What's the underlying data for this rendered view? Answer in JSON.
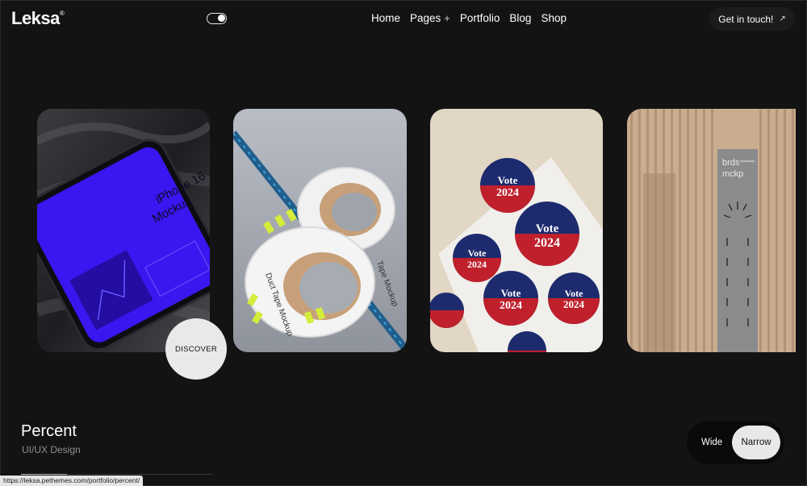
{
  "brand": {
    "logo": "Leksa",
    "logo_mark": "®"
  },
  "nav": {
    "items": [
      {
        "label": "Home"
      },
      {
        "label": "Pages",
        "suffix": "+"
      },
      {
        "label": "Portfolio"
      },
      {
        "label": "Blog"
      },
      {
        "label": "Shop"
      }
    ]
  },
  "cta": {
    "label": "Get in touch!",
    "icon": "arrow-up-right-icon"
  },
  "cards": {
    "card1": {
      "title1": "iPhone 16",
      "title2": "Mockup"
    },
    "card2": {
      "tape_a": "Duct Tape Mockup",
      "tape_b": "Tape Mockup"
    },
    "card3": {
      "badge_word": "Vote",
      "badge_year": "2024"
    },
    "card4": {
      "sign_top": "brds",
      "sign_bottom": "mckp"
    }
  },
  "discover": {
    "label": "DISCOVER"
  },
  "project": {
    "title": "Percent",
    "category": "UI/UX Design",
    "progress": 0.24
  },
  "layout_switch": {
    "wide": "Wide",
    "narrow": "Narrow",
    "selected": "narrow"
  },
  "status_bar": {
    "url": "https://leksa.pethemes.com/portfolio/percent/"
  },
  "colors": {
    "background": "#131313",
    "accent_purple": "#3a16f0",
    "tape_lime": "#d4ec3a",
    "vote_red": "#c0202c",
    "vote_blue": "#1d2b6e"
  }
}
